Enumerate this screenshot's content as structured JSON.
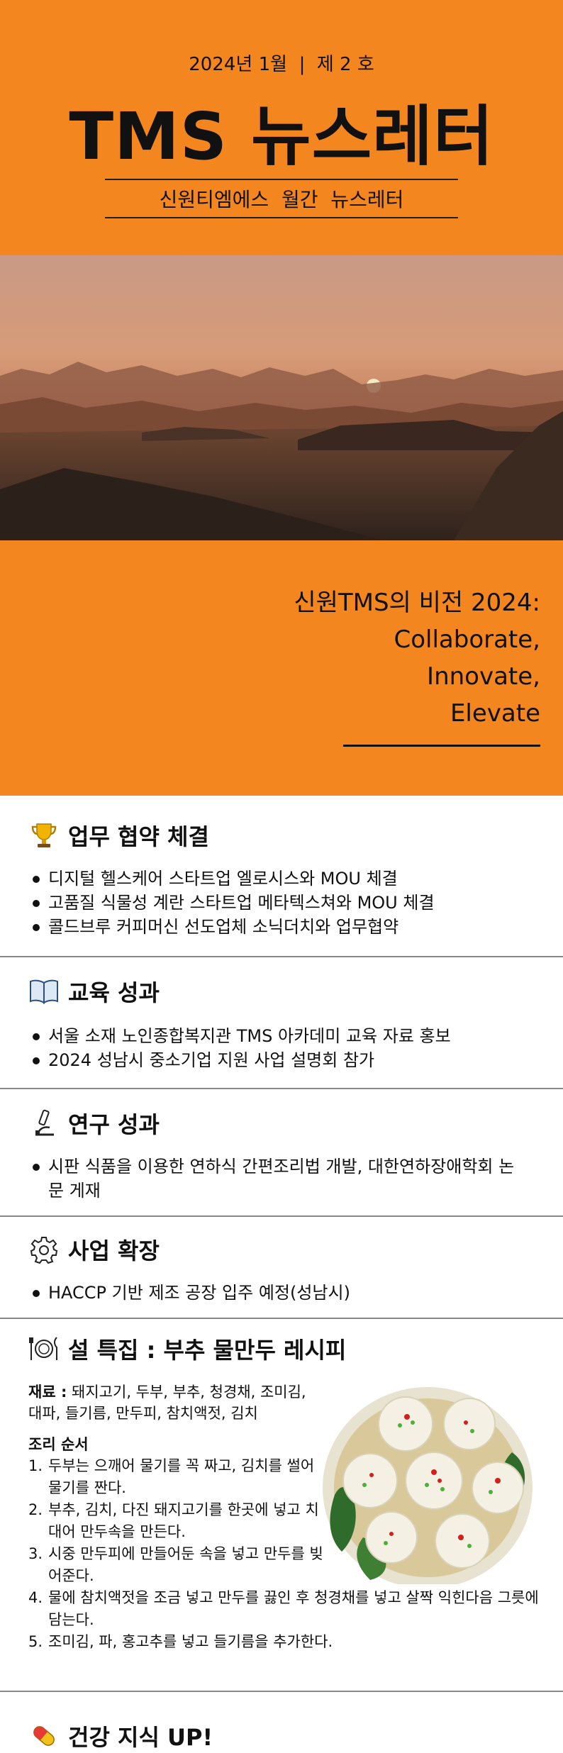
{
  "header": {
    "issue": "2024년 1월  |  제 2 호",
    "title": "TMS 뉴스레터",
    "subtitle": "신원티엠에스  월간  뉴스레터"
  },
  "vision": {
    "line1": "신원TMS의 비전 2024:",
    "line2": "Collaborate,",
    "line3": "Innovate,",
    "line4": "Elevate"
  },
  "sections": {
    "mou": {
      "icon": "trophy-icon",
      "title": "업무 협약 체결",
      "items": [
        "디지털 헬스케어 스타트업 엘로시스와 MOU 체결",
        "고품질 식물성 계란 스타트업 메타텍스쳐와 MOU 체결",
        "콜드브루 커피머신 선도업체 소닉더치와 업무협약"
      ]
    },
    "education": {
      "icon": "book-icon",
      "title": "교육 성과",
      "items": [
        "서울 소재 노인종합복지관 TMS 아카데미 교육 자료 홍보",
        "2024 성남시 중소기업 지원 사업 설명회 참가"
      ]
    },
    "research": {
      "icon": "microscope-icon",
      "title": "연구 성과",
      "items": [
        "시판 식품을 이용한 연하식 간편조리법 개발, 대한연하장애학회 논문 게재"
      ]
    },
    "business": {
      "icon": "gear-icon",
      "title": "사업 확장",
      "items": [
        "HACCP 기반 제조 공장 입주 예정(성남시)"
      ]
    },
    "recipe": {
      "icon": "plate-icon",
      "title": "설 특집 : 부추 물만두 레시피",
      "ingredients_label": "재료 :",
      "ingredients": " 돼지고기, 두부, 부추, 청경채, 조미김, 대파, 들기름, 만두피, 참치액젓, 김치",
      "steps_label": "조리 순서",
      "steps": [
        "두부는 으깨어 물기를 꼭 짜고, 김치를 썰어 물기를 짠다.",
        "부추, 김치, 다진 돼지고기를 한곳에 넣고 치대어 만두속을 만든다.",
        "시중 만두피에 만들어둔 속을 넣고 만두를 빚어준다.",
        "물에 참치액젓을 조금 넣고 만두를 끓인 후 청경채를 넣고 살짝 익힌다음 그릇에 담는다.",
        "조미김, 파, 홍고추를 넣고 들기름을 추가한다."
      ]
    },
    "health": {
      "icon": "pill-icon",
      "title": "건강 지식 UP!"
    }
  },
  "colors": {
    "accent": "#f4861f",
    "text": "#111111",
    "divider": "#888888"
  }
}
